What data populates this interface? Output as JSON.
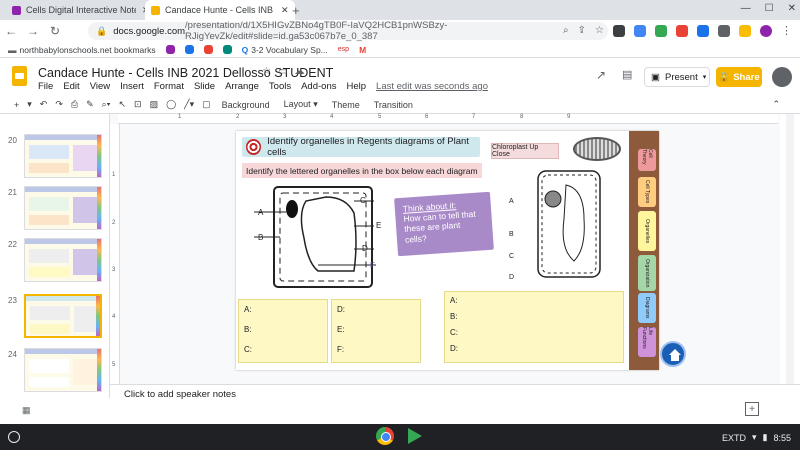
{
  "browser": {
    "tabs": [
      {
        "title": "Cells Digital Interactive Note",
        "favicon_color": "#8e24aa",
        "active": false
      },
      {
        "title": "Candace Hunte - Cells INB 2021",
        "favicon_color": "#f4b400",
        "active": true
      }
    ],
    "url_domain": "docs.google.com",
    "url_path": "/presentation/d/1X5HIGvZBNo4gTB0F-IaVQ2HCB1pnWSBzy-RJigYevZk/edit#slide=id.ga53c067b7e_0_387",
    "bookmarks": [
      {
        "label": "northbabylonschools.net bookmarks",
        "icon": "folder-icon"
      },
      {
        "label": "",
        "icon": "purple-app-icon"
      },
      {
        "label": "",
        "icon": "blue-app-icon"
      },
      {
        "label": "",
        "icon": "red-app-icon"
      },
      {
        "label": "",
        "icon": "teal-app-icon"
      },
      {
        "label": "3-2 Vocabulary Sp...",
        "icon": "q-icon"
      },
      {
        "label": "esp",
        "icon": "esp-icon"
      },
      {
        "label": "",
        "icon": "gmail-icon"
      }
    ]
  },
  "doc": {
    "title": "Candace Hunte - Cells INB 2021 Dellosso STUDENT",
    "menu": [
      "File",
      "Edit",
      "View",
      "Insert",
      "Format",
      "Slide",
      "Arrange",
      "Tools",
      "Add-ons",
      "Help"
    ],
    "last_edit": "Last edit was seconds ago",
    "present_label": "Present",
    "share_label": "Share"
  },
  "toolbar": {
    "background": "Background",
    "layout": "Layout",
    "theme": "Theme",
    "transition": "Transition"
  },
  "filmstrip": {
    "slides": [
      "20",
      "21",
      "22",
      "23",
      "24"
    ],
    "selected": "23"
  },
  "ruler": {
    "top_ticks": [
      "1",
      "2",
      "3",
      "4",
      "5",
      "6",
      "7",
      "8",
      "9"
    ],
    "left_ticks": [
      "1",
      "2",
      "3",
      "4",
      "5"
    ]
  },
  "slide": {
    "banner": "Identify organelles in Regents diagrams of Plant cells",
    "subbanner": "Identify the lettered organelles in the box below each diagram",
    "chloroplast_label": "Chloroplast Up Close",
    "think_title": "Think about it:",
    "think_body": "How can to tell that these are plant cells?",
    "left_cell_labels": [
      "A",
      "B",
      "C",
      "E",
      "D",
      "F"
    ],
    "right_cell_labels": [
      "A",
      "B",
      "C",
      "D"
    ],
    "answers_left": [
      "A:",
      "B:",
      "C:"
    ],
    "answers_mid": [
      "D:",
      "E:",
      "F:"
    ],
    "answers_right": [
      "A:",
      "B:",
      "C:",
      "D:"
    ],
    "side_tabs": [
      {
        "label": "Cell Theory",
        "color": "#ef9a9a"
      },
      {
        "label": "Cell Types",
        "color": "#ffcc80"
      },
      {
        "label": "Organelles",
        "color": "#fff59d"
      },
      {
        "label": "Organization",
        "color": "#a5d6a7"
      },
      {
        "label": "Diagrams",
        "color": "#90caf9"
      },
      {
        "label": "Life Functions",
        "color": "#ce93d8"
      }
    ]
  },
  "notes": {
    "placeholder": "Click to add speaker notes"
  },
  "shelf": {
    "ime": "EXTD",
    "time": "8:55"
  }
}
